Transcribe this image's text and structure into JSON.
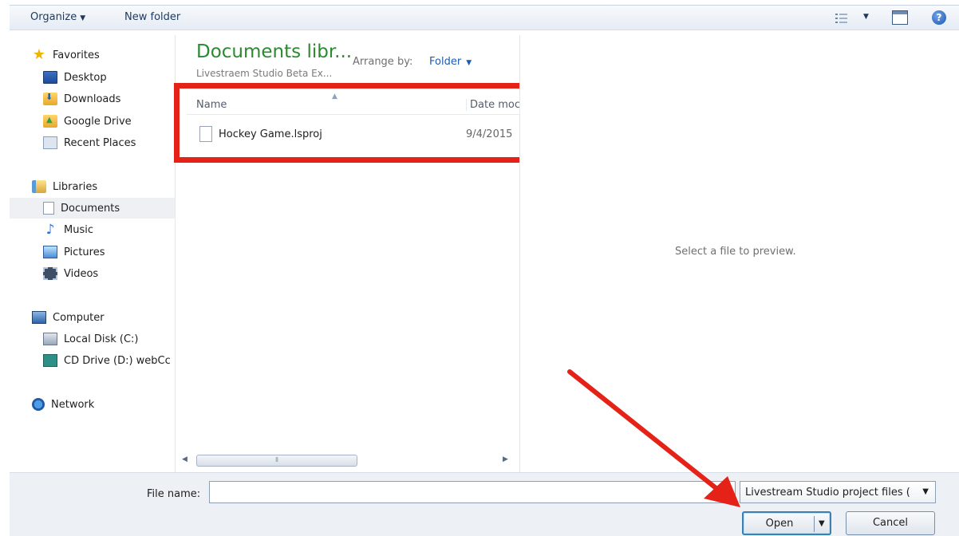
{
  "toolbar": {
    "organize_label": "Organize",
    "new_folder_label": "New folder"
  },
  "nav": {
    "favorites": {
      "header": "Favorites",
      "items": [
        {
          "label": "Desktop",
          "icon": "desktop-icon"
        },
        {
          "label": "Downloads",
          "icon": "downloads-folder-icon"
        },
        {
          "label": "Google Drive",
          "icon": "google-drive-folder-icon"
        },
        {
          "label": "Recent Places",
          "icon": "recent-places-icon"
        }
      ]
    },
    "libraries": {
      "header": "Libraries",
      "items": [
        {
          "label": "Documents",
          "icon": "documents-icon",
          "selected": true
        },
        {
          "label": "Music",
          "icon": "music-icon"
        },
        {
          "label": "Pictures",
          "icon": "pictures-icon"
        },
        {
          "label": "Videos",
          "icon": "videos-icon"
        }
      ]
    },
    "computer": {
      "header": "Computer",
      "items": [
        {
          "label": "Local Disk (C:)",
          "icon": "local-disk-icon"
        },
        {
          "label": "CD Drive (D:) webCc",
          "icon": "cd-drive-icon"
        }
      ]
    },
    "network": {
      "header": "Network"
    }
  },
  "library": {
    "title": "Documents libr...",
    "subtitle": "Livestraem Studio Beta Ex...",
    "arrange_by_label": "Arrange by:",
    "arrange_by_value": "Folder"
  },
  "columns": {
    "name": "Name",
    "date": "Date moc"
  },
  "files": [
    {
      "name": "Hockey Game.lsproj",
      "date": "9/4/2015"
    }
  ],
  "preview": {
    "message": "Select a file to preview."
  },
  "footer": {
    "file_name_label": "File name:",
    "file_name_value": "",
    "file_type_filter": "Livestream Studio project files (",
    "open_label": "Open",
    "cancel_label": "Cancel"
  },
  "annotation_color": "#e42218"
}
